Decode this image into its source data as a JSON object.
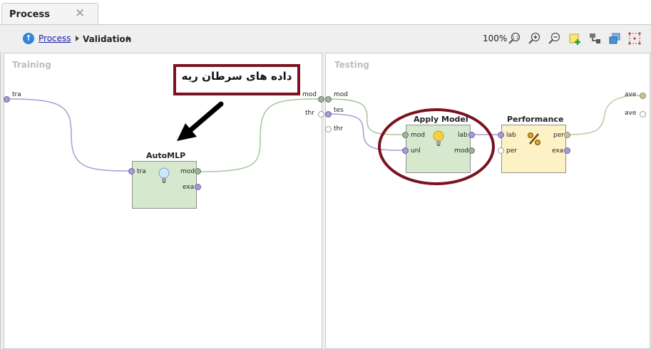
{
  "tab": {
    "title": "Process",
    "close_glyph": "✕"
  },
  "breadcrumb": {
    "icon": "up-arrow-icon",
    "link": "Process",
    "current": "Validation"
  },
  "toolbar": {
    "zoom": "100%",
    "buttons": [
      "zoom-fit-icon",
      "zoom-in-icon",
      "zoom-out-icon",
      "add-note-icon",
      "auto-wire-icon",
      "arrange-icon",
      "select-all-icon"
    ]
  },
  "training": {
    "title": "Training",
    "left_port": "tra",
    "right_ports": [
      "mod"
    ],
    "operator": {
      "title": "AutoMLP",
      "in": [
        "tra"
      ],
      "out": [
        "mod",
        "exa"
      ],
      "icon": "lightbulb-icon"
    },
    "annotation": "داده های سرطان ریه"
  },
  "testing": {
    "title": "Testing",
    "left_ports": [
      "mod",
      "tes",
      "thr"
    ],
    "right_ports": [
      "ave",
      "ave"
    ],
    "apply_model": {
      "title": "Apply Model",
      "in": [
        "mod",
        "unl"
      ],
      "out": [
        "lab",
        "mod"
      ],
      "icon": "lightbulb-icon"
    },
    "performance": {
      "title": "Performance",
      "in": [
        "lab",
        "per"
      ],
      "out": [
        "per",
        "exa"
      ],
      "icon": "percent-icon"
    }
  },
  "divider_port": "thr",
  "colors": {
    "annotation_border": "#7a1220",
    "highlight_ellipse": "#7a1220",
    "link": "#1a1aa8",
    "operator_green": "#d6e9cf",
    "operator_yellow": "#fdf2c6"
  }
}
